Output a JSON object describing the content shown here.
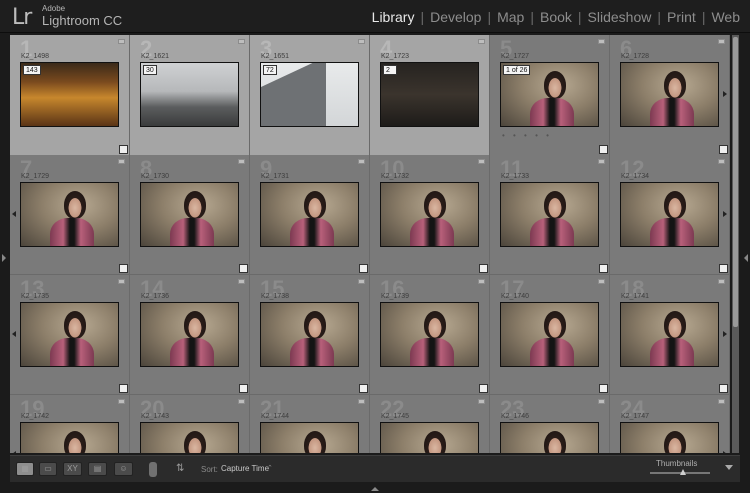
{
  "app": {
    "logo": "Lr",
    "vendor": "Adobe",
    "name": "Lightroom CC"
  },
  "modules": [
    {
      "label": "Library",
      "active": true
    },
    {
      "label": "Develop",
      "active": false
    },
    {
      "label": "Map",
      "active": false
    },
    {
      "label": "Book",
      "active": false
    },
    {
      "label": "Slideshow",
      "active": false
    },
    {
      "label": "Print",
      "active": false
    },
    {
      "label": "Web",
      "active": false
    }
  ],
  "grid": {
    "cells": [
      {
        "num": "1",
        "fname": "K2_1498",
        "photo": "library",
        "badge": "143",
        "selected": true
      },
      {
        "num": "2",
        "fname": "K2_1621",
        "photo": "street",
        "badge": "30",
        "selected": true
      },
      {
        "num": "3",
        "fname": "K2_1651",
        "photo": "arch",
        "badge": "72",
        "selected": true
      },
      {
        "num": "4",
        "fname": "K2_1723",
        "photo": "interior",
        "badge": "2",
        "selected": true
      },
      {
        "num": "5",
        "fname": "K2_1727",
        "photo": "portrait",
        "badge": "1 of 26",
        "selected": false
      },
      {
        "num": "6",
        "fname": "K2_1728",
        "photo": "portrait",
        "badge": "",
        "selected": false
      },
      {
        "num": "7",
        "fname": "K2_1729",
        "photo": "portrait",
        "badge": "",
        "selected": false
      },
      {
        "num": "8",
        "fname": "K2_1730",
        "photo": "portrait",
        "badge": "",
        "selected": false
      },
      {
        "num": "9",
        "fname": "K2_1731",
        "photo": "portrait",
        "badge": "",
        "selected": false
      },
      {
        "num": "10",
        "fname": "K2_1732",
        "photo": "portrait",
        "badge": "",
        "selected": false
      },
      {
        "num": "11",
        "fname": "K2_1733",
        "photo": "portrait",
        "badge": "",
        "selected": false
      },
      {
        "num": "12",
        "fname": "K2_1734",
        "photo": "portrait",
        "badge": "",
        "selected": false
      },
      {
        "num": "13",
        "fname": "K2_1735",
        "photo": "portrait",
        "badge": "",
        "selected": false
      },
      {
        "num": "14",
        "fname": "K2_1736",
        "photo": "portrait",
        "badge": "",
        "selected": false
      },
      {
        "num": "15",
        "fname": "K2_1738",
        "photo": "portrait",
        "badge": "",
        "selected": false
      },
      {
        "num": "16",
        "fname": "K2_1739",
        "photo": "portrait",
        "badge": "",
        "selected": false
      },
      {
        "num": "17",
        "fname": "K2_1740",
        "photo": "portrait",
        "badge": "",
        "selected": false
      },
      {
        "num": "18",
        "fname": "K2_1741",
        "photo": "portrait",
        "badge": "",
        "selected": false
      },
      {
        "num": "19",
        "fname": "K2_1742",
        "photo": "portrait",
        "badge": "",
        "selected": false
      },
      {
        "num": "20",
        "fname": "K2_1743",
        "photo": "portrait",
        "badge": "",
        "selected": false
      },
      {
        "num": "21",
        "fname": "K2_1744",
        "photo": "portrait",
        "badge": "",
        "selected": false
      },
      {
        "num": "22",
        "fname": "K2_1745",
        "photo": "portrait",
        "badge": "",
        "selected": false
      },
      {
        "num": "23",
        "fname": "K2_1746",
        "photo": "portrait",
        "badge": "",
        "selected": false
      },
      {
        "num": "24",
        "fname": "K2_1747",
        "photo": "portrait",
        "badge": "",
        "selected": false
      }
    ]
  },
  "toolbar": {
    "sort_label": "Sort:",
    "sort_value": "Capture Time",
    "thumbnails_label": "Thumbnails",
    "thumbnail_size": 0.55
  }
}
